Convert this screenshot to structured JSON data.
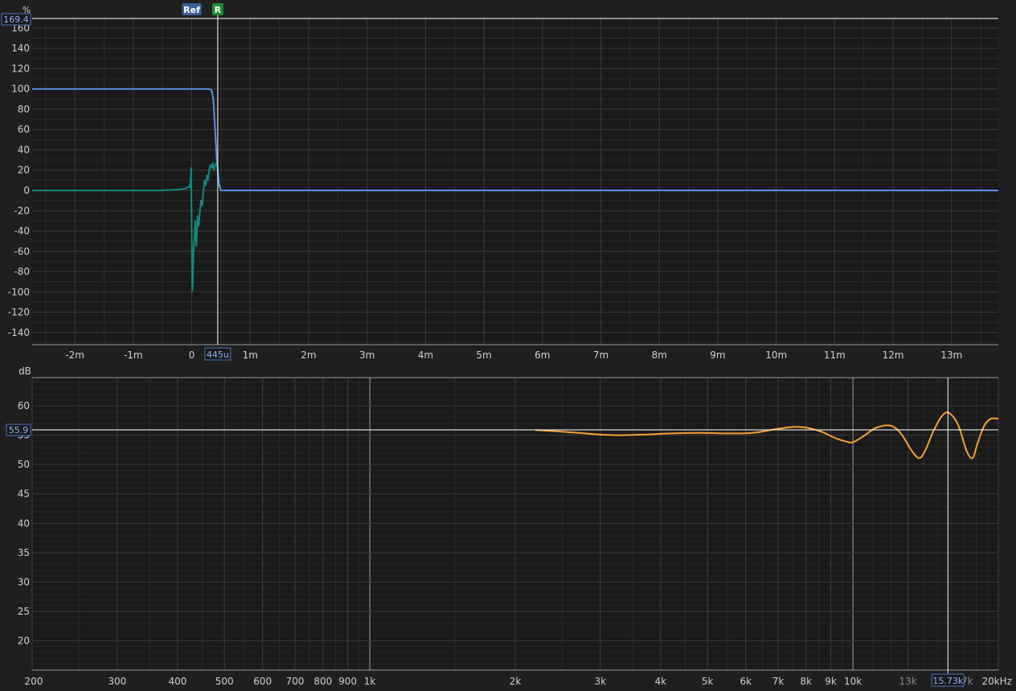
{
  "colors": {
    "background": "#1f1f1f",
    "plot_background": "#1a1a1a",
    "grid_major": "#3c3c3c",
    "grid_minor": "#2b2b2b",
    "axis_text": "#d0d0d0",
    "cursor": "#ffffff",
    "step_trace": "#5b8ee0",
    "impulse_trace": "#16867d",
    "spl_trace": "#f5a033",
    "marker_ref": "#3a5f9a",
    "marker_r": "#1e8a2e",
    "readout_border": "#4a76c6",
    "readout_text": "#8fb5f5"
  },
  "markers": {
    "ref_label": "Ref",
    "r_label": "R"
  },
  "chart_data": [
    {
      "type": "line",
      "name": "impulse-step-panel",
      "ylabel": "%",
      "ylim": [
        -152,
        169.4
      ],
      "xlim_ms": [
        -2.73,
        13.8
      ],
      "xtick_values_ms": [
        -2,
        -1,
        0,
        1,
        2,
        3,
        4,
        5,
        6,
        7,
        8,
        9,
        10,
        11,
        12,
        13
      ],
      "xtick_labels": [
        "-2m",
        "-1m",
        "0",
        "1m",
        "2m",
        "3m",
        "4m",
        "5m",
        "6m",
        "7m",
        "8m",
        "9m",
        "10m",
        "11m",
        "12m",
        "13m"
      ],
      "ytick_values": [
        160,
        140,
        120,
        100,
        80,
        60,
        40,
        20,
        0,
        -20,
        -40,
        -60,
        -80,
        -100,
        -120,
        -140
      ],
      "ytick_labels": [
        "160",
        "140",
        "120",
        "100",
        "80",
        "60",
        "40",
        "20",
        "0",
        "-20",
        "-40",
        "-60",
        "-80",
        "-100",
        "-120",
        "-140"
      ],
      "cursor": {
        "x_ms": 0.445,
        "x_label": "445u",
        "y": 169.4,
        "y_label": "169.4"
      },
      "ref_marker_x_ms": 0.0,
      "series": [
        {
          "color": "#5b8ee0",
          "x": [
            -2.73,
            0.3,
            0.34,
            0.37,
            0.4,
            0.43,
            0.46,
            0.5,
            13.8
          ],
          "y": [
            100,
            100,
            99,
            90,
            60,
            30,
            8,
            0,
            0
          ]
        },
        {
          "color": "#16867d",
          "x": [
            -2.73,
            -1.5,
            -1.0,
            -0.5,
            -0.2,
            -0.1,
            -0.05,
            -0.03,
            -0.02,
            -0.01,
            0.0,
            0.01,
            0.02,
            0.03,
            0.05,
            0.06,
            0.08,
            0.1,
            0.12,
            0.14,
            0.16,
            0.18,
            0.2,
            0.22,
            0.24,
            0.26,
            0.28,
            0.3,
            0.32,
            0.34,
            0.36,
            0.38,
            0.4,
            0.42,
            0.44,
            0.47,
            0.5,
            13.8
          ],
          "y": [
            0,
            0,
            0,
            0,
            1,
            2,
            4,
            3,
            10,
            22,
            -40,
            -99,
            -90,
            -60,
            -45,
            -30,
            -55,
            -25,
            -35,
            -20,
            -10,
            -15,
            0,
            10,
            5,
            15,
            10,
            20,
            25,
            22,
            27,
            20,
            25,
            27,
            25,
            5,
            0,
            0
          ]
        }
      ]
    },
    {
      "type": "line",
      "name": "spl-panel",
      "ylabel": "dB",
      "ylim": [
        15,
        64.8
      ],
      "xlim_hz": [
        200,
        20000
      ],
      "x_scale": "log",
      "xtick_values_hz": [
        200,
        300,
        400,
        500,
        600,
        700,
        800,
        900,
        1000,
        2000,
        3000,
        4000,
        5000,
        6000,
        7000,
        8000,
        9000,
        10000,
        13000,
        20000
      ],
      "xtick_labels": [
        "200",
        "300",
        "400",
        "500",
        "600",
        "700",
        "800",
        "900",
        "1k",
        "2k",
        "3k",
        "4k",
        "5k",
        "6k",
        "7k",
        "8k",
        "9k",
        "10k",
        "13k",
        "20kHz"
      ],
      "dim_xtick_values_hz": [
        17000
      ],
      "dim_xtick_labels": [
        "17k"
      ],
      "ytick_values": [
        60,
        55,
        50,
        45,
        40,
        35,
        30,
        25,
        20
      ],
      "ytick_labels": [
        "60",
        "55",
        "50",
        "45",
        "40",
        "35",
        "30",
        "25",
        "20"
      ],
      "cursor": {
        "x_hz": 15730,
        "x_label": "15.73k",
        "y": 55.9,
        "y_label": "55.9"
      },
      "series": [
        {
          "color": "#f5a033",
          "x": [
            2200,
            2600,
            3000,
            3300,
            3700,
            4200,
            4800,
            5500,
            6200,
            6900,
            7500,
            8000,
            8600,
            9200,
            9700,
            10000,
            10500,
            11200,
            12000,
            12600,
            13200,
            13700,
            14100,
            14700,
            15300,
            15800,
            16500,
            17200,
            17700,
            18100,
            18700,
            19300,
            20000
          ],
          "y": [
            55.9,
            55.5,
            55.1,
            55.0,
            55.1,
            55.3,
            55.4,
            55.3,
            55.4,
            56.0,
            56.4,
            56.3,
            55.6,
            54.5,
            53.9,
            53.8,
            54.8,
            56.3,
            56.6,
            55.2,
            52.5,
            51.1,
            52.3,
            55.8,
            58.3,
            58.8,
            56.8,
            52.3,
            51.1,
            53.5,
            56.6,
            57.8,
            57.8
          ]
        }
      ]
    }
  ]
}
